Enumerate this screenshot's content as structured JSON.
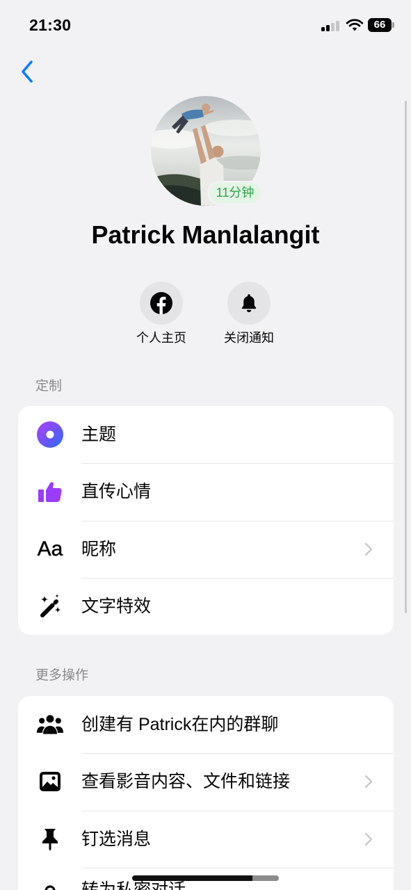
{
  "status_bar": {
    "time": "21:30",
    "battery_level": "66",
    "signal_icon": "signal-icon",
    "wifi_icon": "wifi-icon",
    "battery_icon": "battery-icon"
  },
  "navigation": {
    "back_icon": "chevron-left-icon"
  },
  "profile": {
    "name": "Patrick Manlalangit",
    "last_active": "11分钟",
    "avatar": "profile-photo"
  },
  "quick_actions": [
    {
      "label": "个人主页",
      "icon": "facebook-icon"
    },
    {
      "label": "关闭通知",
      "icon": "bell-icon"
    }
  ],
  "sections": [
    {
      "title": "定制",
      "items": [
        {
          "label": "主题",
          "icon": "theme-icon",
          "has_chevron": false
        },
        {
          "label": "直传心情",
          "icon": "thumbs-up-icon",
          "has_chevron": false
        },
        {
          "label": "昵称",
          "icon": "nickname-icon",
          "icon_text": "Aa",
          "has_chevron": true
        },
        {
          "label": "文字特效",
          "icon": "magic-wand-icon",
          "has_chevron": false
        }
      ]
    },
    {
      "title": "更多操作",
      "items": [
        {
          "label": "创建有 Patrick在内的群聊",
          "icon": "group-icon",
          "has_chevron": false
        },
        {
          "label": "查看影音内容、文件和链接",
          "icon": "media-icon",
          "has_chevron": true
        },
        {
          "label": "钉选消息",
          "icon": "pin-icon",
          "has_chevron": true
        },
        {
          "label": "转为私密对话",
          "icon": "lock-icon",
          "has_chevron": false
        }
      ]
    }
  ],
  "colors": {
    "accent": "#0a7cff",
    "background": "#f2f2f4",
    "card": "#ffffff",
    "secondary_text": "#8a8a8e",
    "active_badge_text": "#31a24c",
    "active_badge_bg": "#e3f5e5",
    "thumbs_up": "#9b3bff",
    "theme_gradient": [
      "#b43cf5",
      "#2a6bff"
    ]
  }
}
